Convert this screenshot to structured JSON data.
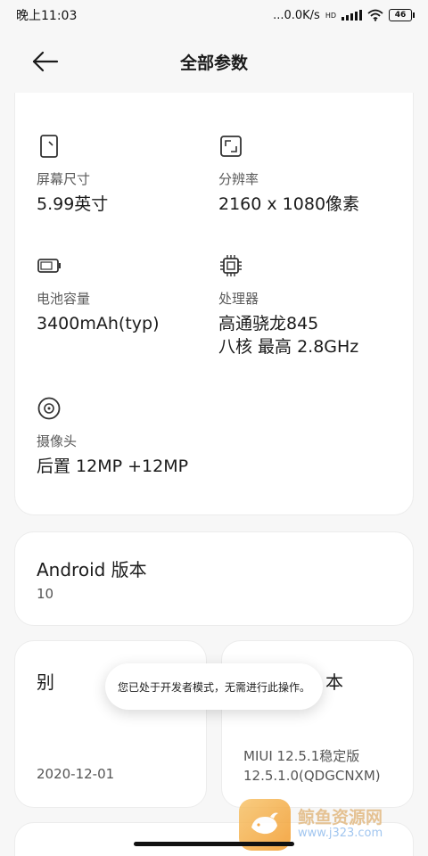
{
  "statusbar": {
    "time": "晚上11:03",
    "network_speed": "...0.0K/s",
    "network_type": "HD",
    "battery_level": "46"
  },
  "header": {
    "title": "全部参数",
    "back_icon": "arrow-left-icon"
  },
  "specs": {
    "screen": {
      "icon": "phone-screen-icon",
      "label": "屏幕尺寸",
      "value": "5.99英寸"
    },
    "resolution": {
      "icon": "resolution-icon",
      "label": "分辨率",
      "value": "2160 x 1080像素"
    },
    "battery": {
      "icon": "battery-icon",
      "label": "电池容量",
      "value": "3400mAh(typ)"
    },
    "processor": {
      "icon": "chip-icon",
      "label": "处理器",
      "value_line1": "高通骁龙845",
      "value_line2": "八核 最高 2.8GHz"
    },
    "camera": {
      "icon": "camera-lens-icon",
      "label": "摄像头",
      "value": "后置 12MP +12MP"
    }
  },
  "android": {
    "title": "Android 版本",
    "value": "10"
  },
  "security_patch": {
    "title_visible": "别",
    "value": "2020-12-01"
  },
  "miui": {
    "title_visible": "本",
    "value_line1": "MIUI 12.5.1稳定版",
    "value_line2": "12.5.1.0(QDGCNXM)"
  },
  "toast": {
    "message": "您已处于开发者模式，无需进行此操作。"
  },
  "watermark": {
    "name": "鲸鱼资源网",
    "url": "www.j323.com",
    "icon": "whale-logo-icon"
  }
}
